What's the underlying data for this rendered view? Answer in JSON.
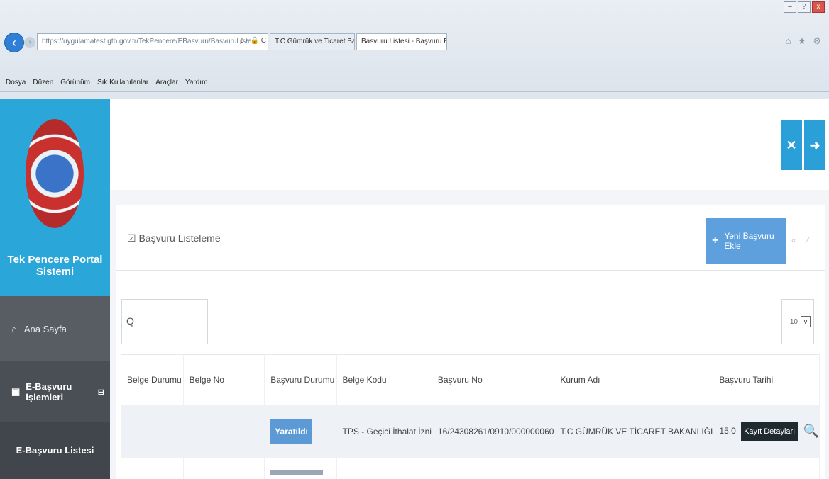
{
  "browser": {
    "window_controls": [
      "–",
      "?",
      "x"
    ],
    "back_icon": "‹",
    "forward_icon": "›",
    "address": "https://uygulamatest.gtb.gov.tr/TekPencere/EBasvuru/BasvuruListesi",
    "address_controls": "ρ - 🔒 C",
    "tabs": [
      {
        "label": "T.C Gümrük ve Ticaret Bakanl..."
      },
      {
        "label": "Basvuru Listesi - Başvuru Bil... ×"
      }
    ],
    "toolbar_icons": "⌂ ★ ⚙",
    "menu": [
      "Dosya",
      "Düzen",
      "Görünüm",
      "Sık Kullanılanlar",
      "Araçlar",
      "Yardım"
    ]
  },
  "sidebar": {
    "title": "Tek Pencere Portal Sistemi",
    "home_icon": "⌂",
    "home_label": "Ana Sayfa",
    "group_icon": "▣",
    "group_label": "E-Başvuru İşlemleri",
    "group_toggle": "⊟",
    "list_label": "E-Başvuru Listesi"
  },
  "topbar": {
    "btn1_icon": "✕",
    "btn2_icon": "➜"
  },
  "panel": {
    "title": "☑ Başvuru Listeleme",
    "new_button": "Yeni Başvuru Ekle",
    "new_button_icon": "+",
    "tools": "« ∕",
    "search_icon": "Q",
    "search_value": "",
    "page_size": "10",
    "page_size_chevron": "v"
  },
  "table": {
    "headers": [
      "Belge Durumu",
      "Belge No",
      "Başvuru Durumu",
      "Belge Kodu",
      "Başvuru No",
      "Kurum Adı",
      "Başvuru Tarihi"
    ],
    "rows": [
      {
        "belge_durumu": "",
        "belge_no": "",
        "basvuru_durumu": "Yaratıldı",
        "belge_kodu": "TPS - Geçici İthalat İzni",
        "basvuru_no": "16/24308261/0910/000000060",
        "kurum_adi": "T.C GÜMRÜK VE TİCARET BAKANLIĞI",
        "basvuru_tarihi": "15.0",
        "tooltip": "Kayıt Detayları",
        "detail_icon": "🔍"
      }
    ]
  }
}
